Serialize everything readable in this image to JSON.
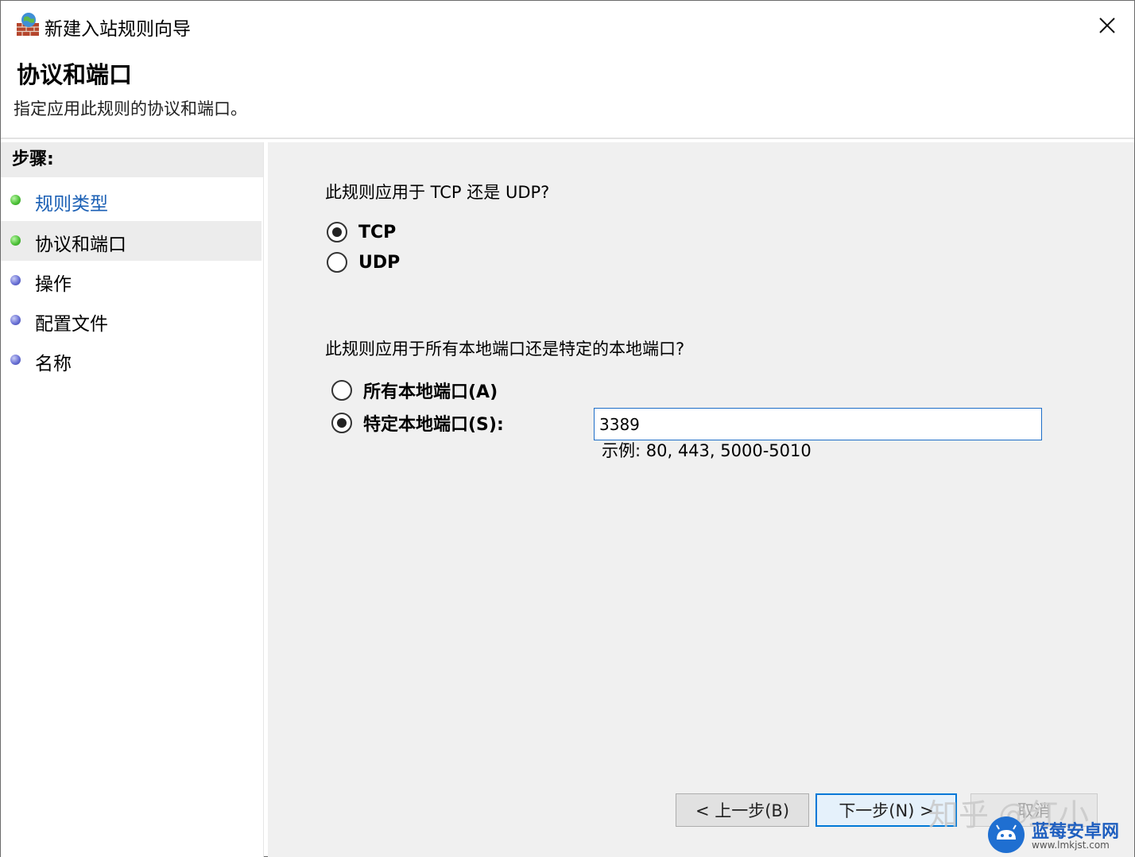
{
  "window": {
    "title": "新建入站规则向导"
  },
  "header": {
    "title": "协议和端口",
    "subtitle": "指定应用此规则的协议和端口。"
  },
  "sidebar": {
    "heading": "步骤:",
    "steps": [
      {
        "label": "规则类型",
        "status": "completed"
      },
      {
        "label": "协议和端口",
        "status": "current"
      },
      {
        "label": "操作",
        "status": "pending"
      },
      {
        "label": "配置文件",
        "status": "pending"
      },
      {
        "label": "名称",
        "status": "pending"
      }
    ]
  },
  "protocol": {
    "question": "此规则应用于 TCP 还是 UDP?",
    "options": [
      {
        "label": "TCP",
        "checked": true
      },
      {
        "label": "UDP",
        "checked": false
      }
    ]
  },
  "ports": {
    "question": "此规则应用于所有本地端口还是特定的本地端口?",
    "options": [
      {
        "label": "所有本地端口(A)",
        "checked": false
      },
      {
        "label": "特定本地端口(S):",
        "checked": true
      }
    ],
    "value": "3389",
    "example": "示例: 80, 443, 5000-5010"
  },
  "buttons": {
    "back": "< 上一步(B)",
    "next": "下一步(N) >",
    "cancel": "取消"
  },
  "watermarks": {
    "zhihu": "知乎 @红小",
    "site_name": "蓝莓安卓网",
    "site_url": "www.lmkjst.com"
  },
  "colors": {
    "accent": "#0078d7",
    "link": "#1a5fb4",
    "completed_dot": "#4fc33a",
    "pending_dot": "#6b72d6",
    "content_bg": "#f0f0f0"
  }
}
